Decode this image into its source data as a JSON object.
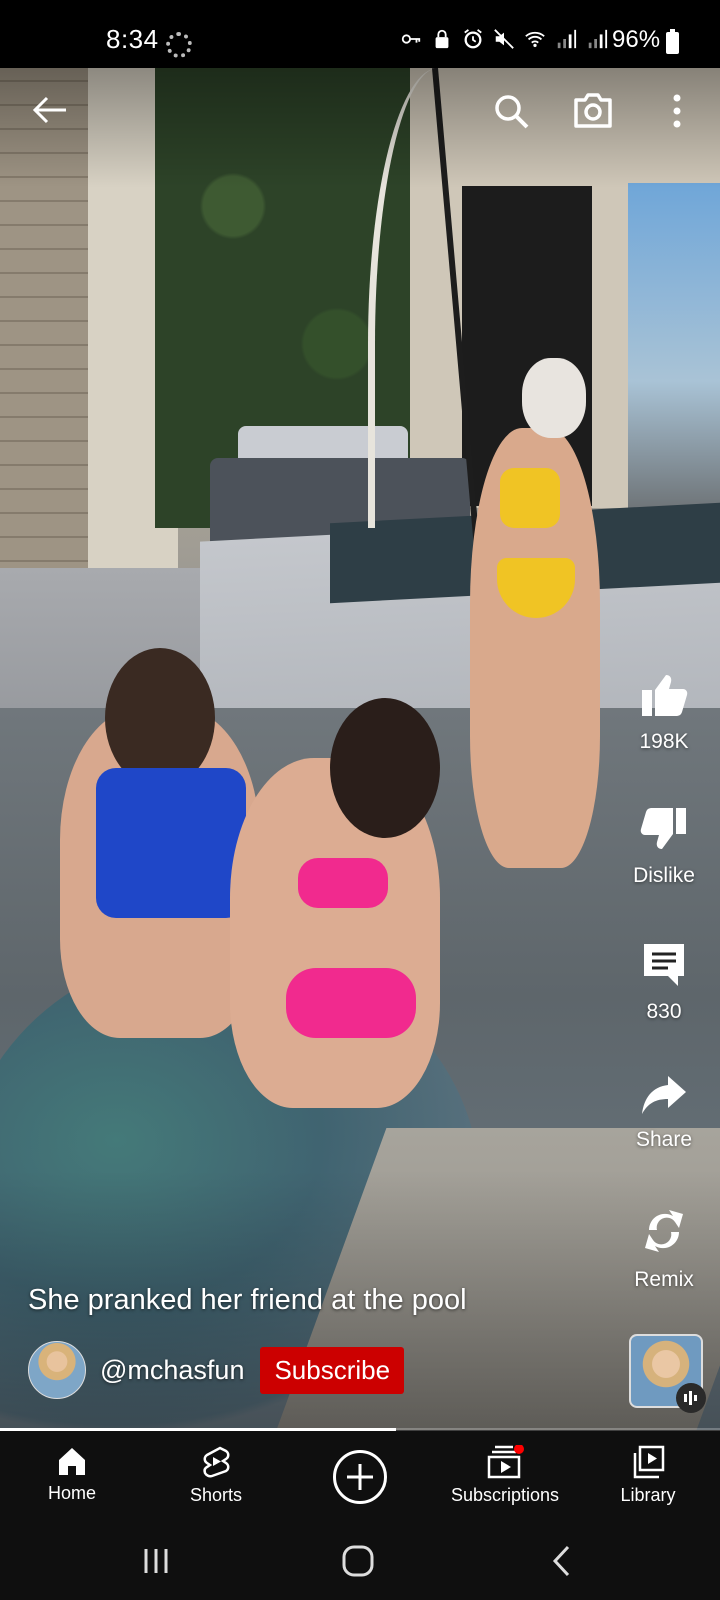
{
  "status_bar": {
    "time": "8:34",
    "battery": "96%",
    "icons": [
      "key-icon",
      "lock-icon",
      "alarm-icon",
      "mute-icon",
      "wifi-icon",
      "signal-icon",
      "signal-icon-2",
      "battery-icon"
    ]
  },
  "video": {
    "caption": "She pranked her friend at the pool",
    "progress": 0.55
  },
  "channel": {
    "handle": "@mchasfun",
    "subscribe_label": "Subscribe"
  },
  "actions": {
    "like_count": "198K",
    "dislike_label": "Dislike",
    "comment_count": "830",
    "share_label": "Share",
    "remix_label": "Remix"
  },
  "nav": {
    "home": "Home",
    "shorts": "Shorts",
    "subscriptions": "Subscriptions",
    "library": "Library"
  },
  "colors": {
    "subscribe": "#cc0000",
    "notification_dot": "#ff0000",
    "nav_background": "#0f0f0f"
  }
}
